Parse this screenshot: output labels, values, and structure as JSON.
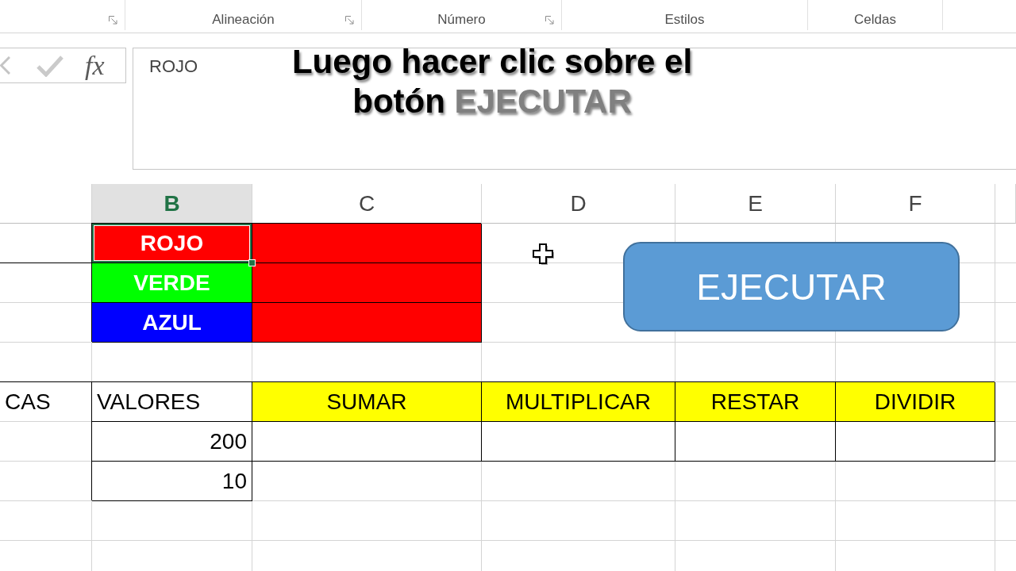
{
  "ribbon": {
    "groups": [
      {
        "launcher": true
      },
      {
        "label": "Alineación",
        "launcher": true
      },
      {
        "label": "Número",
        "launcher": true
      },
      {
        "label": "Estilos",
        "launcher": false
      },
      {
        "label": "Celdas",
        "launcher": false
      }
    ]
  },
  "formula_bar": {
    "function_label": "fx",
    "content": "ROJO"
  },
  "caption": {
    "line_1": "Luego hacer clic sobre el",
    "line_2": "botón",
    "highlight": "EJECUTAR"
  },
  "sheet": {
    "columns": [
      {
        "selected": false
      },
      {
        "label": "B",
        "selected": true
      },
      {
        "label": "C",
        "selected": false
      },
      {
        "label": "D",
        "selected": false
      },
      {
        "label": "E",
        "selected": false
      },
      {
        "label": "F",
        "selected": false
      },
      {
        "selected": false
      }
    ],
    "rows": [
      [
        {
          "boxed": false,
          "border_bottom": true,
          "selected": false
        },
        {
          "text": "ROJO",
          "kind": "text",
          "color": "#ff0000",
          "boxed": true,
          "selected": true
        },
        {
          "color": "#ff0000",
          "boxed": true,
          "selected": false
        }
      ],
      [
        null,
        {
          "text": "VERDE",
          "kind": "text",
          "color": "#00ff00",
          "boxed": true,
          "selected": false
        },
        {
          "color": "#ff0000",
          "boxed": true,
          "selected": false
        }
      ],
      [
        null,
        {
          "text": "AZUL",
          "kind": "text",
          "color": "#0000ff",
          "boxed": true,
          "selected": false
        },
        {
          "color": "#ff0000",
          "boxed": true,
          "selected": false
        }
      ],
      null,
      [
        {
          "text": "CAS",
          "kind": "text",
          "boxed": false,
          "border_top": true,
          "selected": false
        },
        {
          "text": "VALORES",
          "kind": "text",
          "boxed": true,
          "selected": false
        },
        {
          "text": "SUMAR",
          "kind": "text",
          "color": "#ffff00",
          "boxed": true,
          "selected": false
        },
        {
          "text": "MULTIPLICAR",
          "kind": "text",
          "color": "#ffff00",
          "boxed": true,
          "selected": false
        },
        {
          "text": "RESTAR",
          "kind": "text",
          "color": "#ffff00",
          "boxed": true,
          "selected": false
        },
        {
          "text": "DIVIDIR",
          "kind": "text",
          "color": "#ffff00",
          "boxed": true,
          "selected": false
        }
      ],
      [
        null,
        {
          "text": "200",
          "kind": "number",
          "boxed": true,
          "selected": false
        },
        {
          "boxed": true,
          "selected": false
        },
        {
          "boxed": true,
          "selected": false
        },
        {
          "boxed": true,
          "selected": false
        },
        {
          "boxed": true,
          "selected": false
        }
      ],
      [
        null,
        {
          "text": "10",
          "kind": "number",
          "boxed": true,
          "selected": false
        }
      ]
    ]
  },
  "button": {
    "label": "EJECUTAR"
  }
}
